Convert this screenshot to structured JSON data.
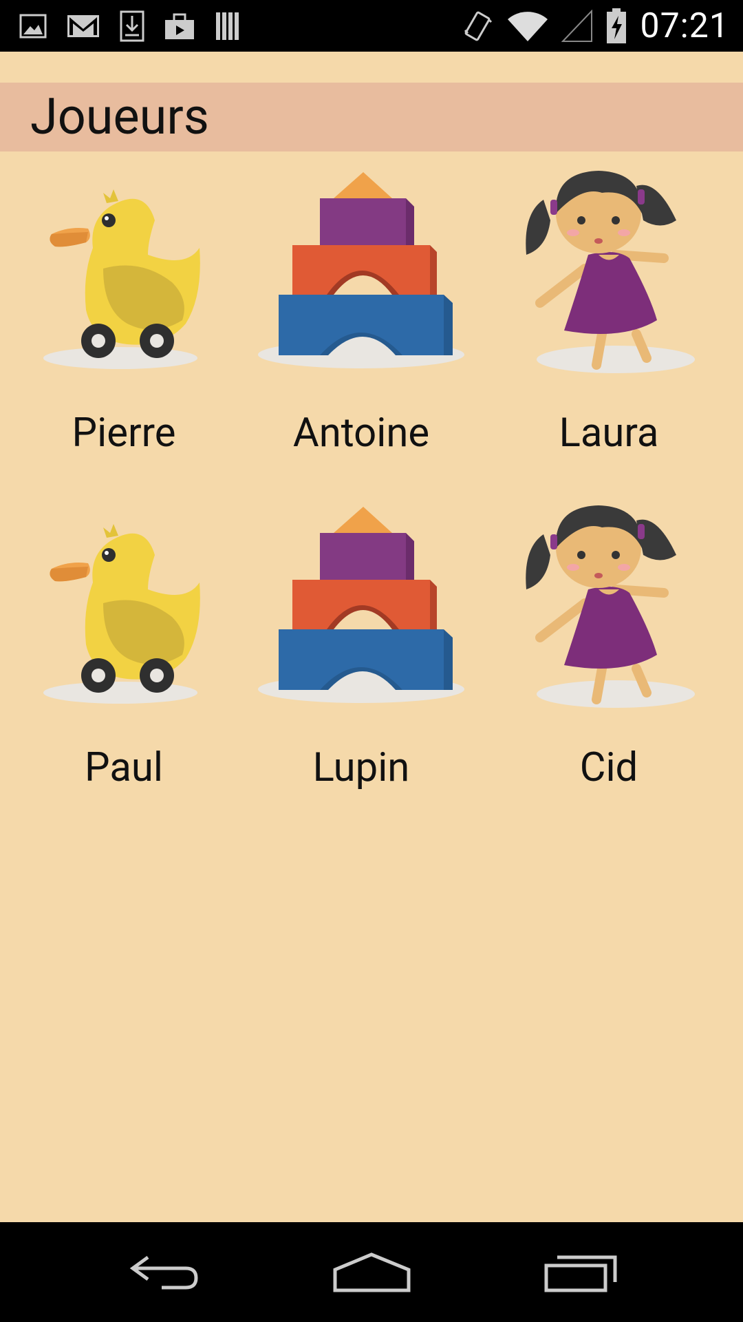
{
  "status_bar": {
    "notification_icons": [
      "gallery-icon",
      "gmail-icon",
      "download-icon",
      "briefcase-icon",
      "barcode-icon"
    ],
    "system_icons": [
      "vibrate-icon",
      "wifi-icon",
      "cell-signal-icon",
      "battery-charging-icon"
    ],
    "time": "07:21"
  },
  "header": {
    "title": "Joueurs"
  },
  "players": [
    {
      "name": "Pierre",
      "avatar": "duck-icon"
    },
    {
      "name": "Antoine",
      "avatar": "blocks-icon"
    },
    {
      "name": "Laura",
      "avatar": "doll-icon"
    },
    {
      "name": "Paul",
      "avatar": "duck-icon"
    },
    {
      "name": "Lupin",
      "avatar": "blocks-icon"
    },
    {
      "name": "Cid",
      "avatar": "doll-icon"
    }
  ],
  "nav_bar": {
    "buttons": [
      "back-icon",
      "home-icon",
      "recents-icon"
    ]
  },
  "colors": {
    "background": "#f5d9aa",
    "header": "#e8bc9e",
    "text": "#111111"
  }
}
